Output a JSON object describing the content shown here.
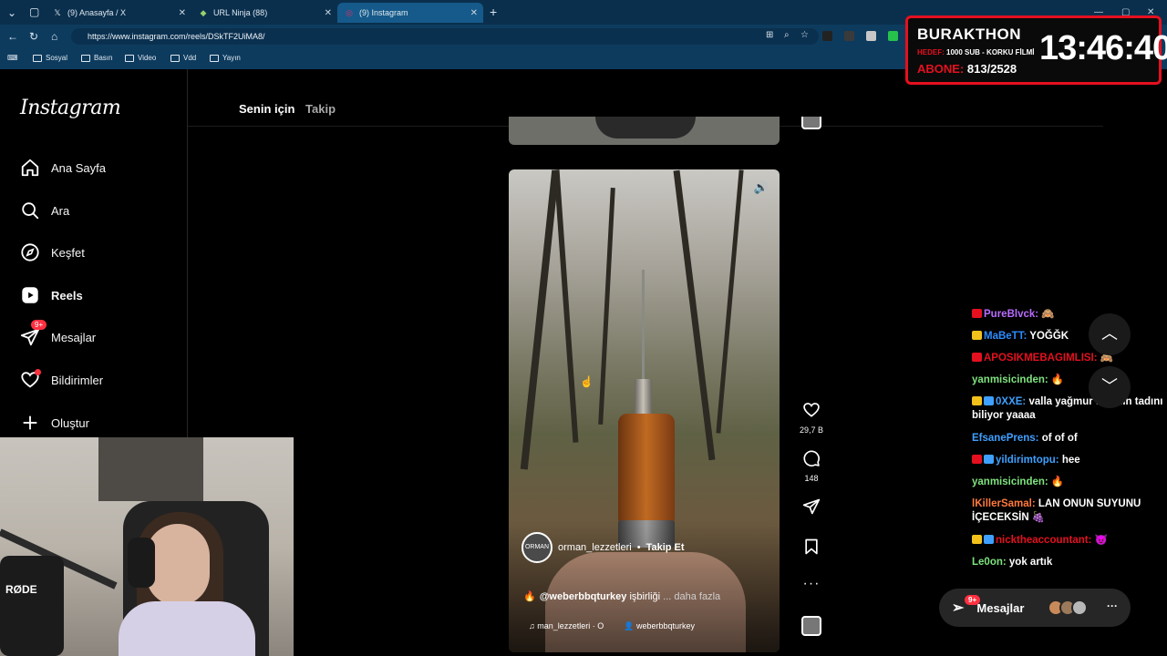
{
  "browser": {
    "tabs": [
      {
        "label": "(9) Anasayfa / X",
        "icon": "x-logo-icon"
      },
      {
        "label": "URL Ninja (88)",
        "icon": "ninja-icon"
      },
      {
        "label": "(9) Instagram",
        "icon": "instagram-icon"
      }
    ],
    "url": "https://www.instagram.com/reels/DSkTF2UiMA8/",
    "bookmarks": [
      "Sosyal",
      "Basın",
      "Video",
      "Vdd",
      "Yayın"
    ]
  },
  "stream_overlay": {
    "title": "BURAKTHON",
    "hedef_label": "HEDEF:",
    "hedef_value": "1000 SUB - KORKU FİLMİ",
    "abone_label": "ABONE:",
    "abone_value": "813/2528",
    "timer": "13:46:40"
  },
  "instagram": {
    "logo": "Instagram",
    "nav": [
      {
        "label": "Ana Sayfa",
        "icon": "home-icon"
      },
      {
        "label": "Ara",
        "icon": "search-icon"
      },
      {
        "label": "Keşfet",
        "icon": "compass-icon"
      },
      {
        "label": "Reels",
        "icon": "reels-icon"
      },
      {
        "label": "Mesajlar",
        "icon": "messages-icon",
        "badge": "9+"
      },
      {
        "label": "Bildirimler",
        "icon": "heart-icon"
      },
      {
        "label": "Oluştur",
        "icon": "plus-icon"
      }
    ],
    "feed_tabs": {
      "for_you": "Senin için",
      "following": "Takip"
    },
    "reel": {
      "creator": "orman_lezzetleri",
      "separator": "•",
      "follow_label": "Takip Et",
      "avatar_text": "ORMAN",
      "caption_handle": "@weberbbqturkey",
      "caption_text": "işbirliği",
      "caption_more": "... daha fazla",
      "audio_left": "man_lezzetleri · O",
      "audio_right": "weberbbqturkey"
    },
    "actions": {
      "likes": "29,7 B",
      "comments": "148"
    },
    "messages_pill": {
      "label": "Mesajlar",
      "badge": "9+"
    }
  },
  "chat": [
    {
      "user": "PureBlvck:",
      "text": "🙈",
      "color": "#b96cff",
      "badge": "#e5101f"
    },
    {
      "user": "MaBeTT:",
      "text": "YOĞĞK",
      "color": "#2b8cff",
      "badge": "#f2c11b"
    },
    {
      "user": "APOSIKMEBAGIMLISI:",
      "text": "🙈",
      "color": "#e5101f",
      "badge": "#e5101f"
    },
    {
      "user": "yanmisicinden:",
      "text": "🔥",
      "color": "#7fe27f",
      "badge": ""
    },
    {
      "user": "0XXE:",
      "text": "valla yağmur ağzının tadını biliyor yaaaa",
      "color": "#3fa0ff",
      "badge": "#f2c11b"
    },
    {
      "user": "EfsanePrens:",
      "text": "of of of",
      "color": "#3fa0ff",
      "badge": ""
    },
    {
      "user": "yildirimtopu:",
      "text": "hee",
      "color": "#3fa0ff",
      "badge": "#e5101f"
    },
    {
      "user": "yanmisicinden:",
      "text": "🔥",
      "color": "#7fe27f",
      "badge": ""
    },
    {
      "user": "lKillerSamal:",
      "text": "LAN ONUN SUYUNU İÇECEKSİN 🍇",
      "color": "#ff7a3d",
      "badge": ""
    },
    {
      "user": "nicktheaccountant:",
      "text": "😈",
      "color": "#e5101f",
      "badge": "#f2c11b"
    },
    {
      "user": "Le0on:",
      "text": "yok artık",
      "color": "#7fe27f",
      "badge": ""
    }
  ],
  "webcam": {
    "mic_brand": "RØDE"
  }
}
